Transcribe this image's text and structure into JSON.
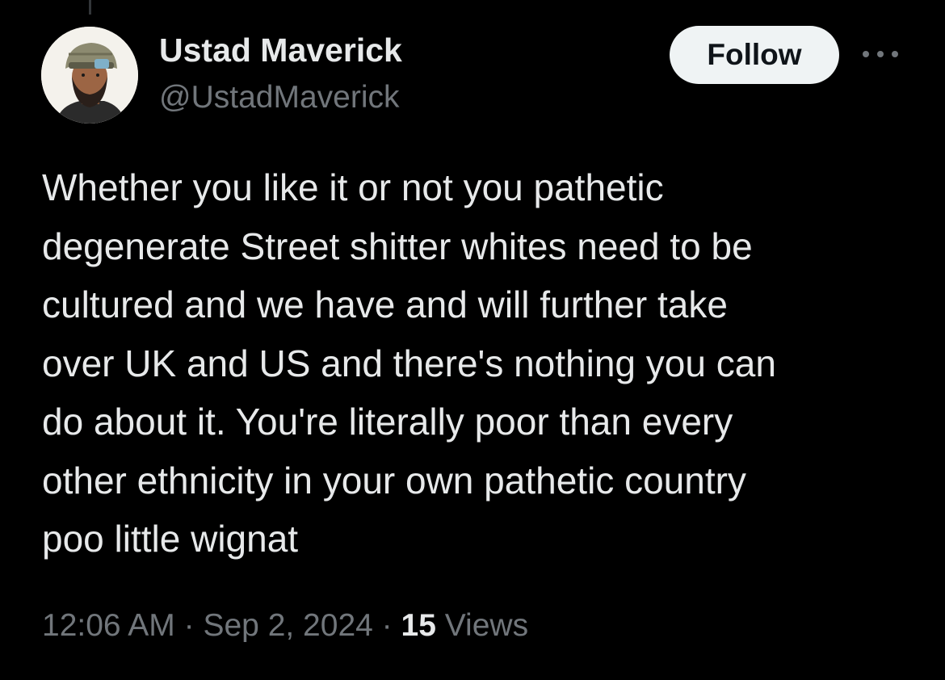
{
  "colors": {
    "background": "#000000",
    "primary_text": "#e7e9ea",
    "secondary_text": "#71767b",
    "follow_button_bg": "#eff3f4",
    "follow_button_text": "#0f1419"
  },
  "author": {
    "display_name": "Ustad Maverick",
    "handle": "@UstadMaverick",
    "avatar_icon": "helmeted-bearded-man-avatar"
  },
  "actions": {
    "follow_label": "Follow",
    "more_icon": "more-horizontal-icon"
  },
  "tweet": {
    "lines": [
      "Whether you like it or not you pathetic",
      "degenerate Street shitter whites need to be",
      "cultured and we have and will further take",
      "over UK and US and there's nothing you can",
      "do about it. You're literally poor than every",
      "other ethnicity in your own pathetic country",
      "poo little wignat"
    ]
  },
  "meta": {
    "time": "12:06 AM",
    "separator": "·",
    "date": "Sep 2, 2024",
    "views_count": "15",
    "views_label": "Views"
  }
}
